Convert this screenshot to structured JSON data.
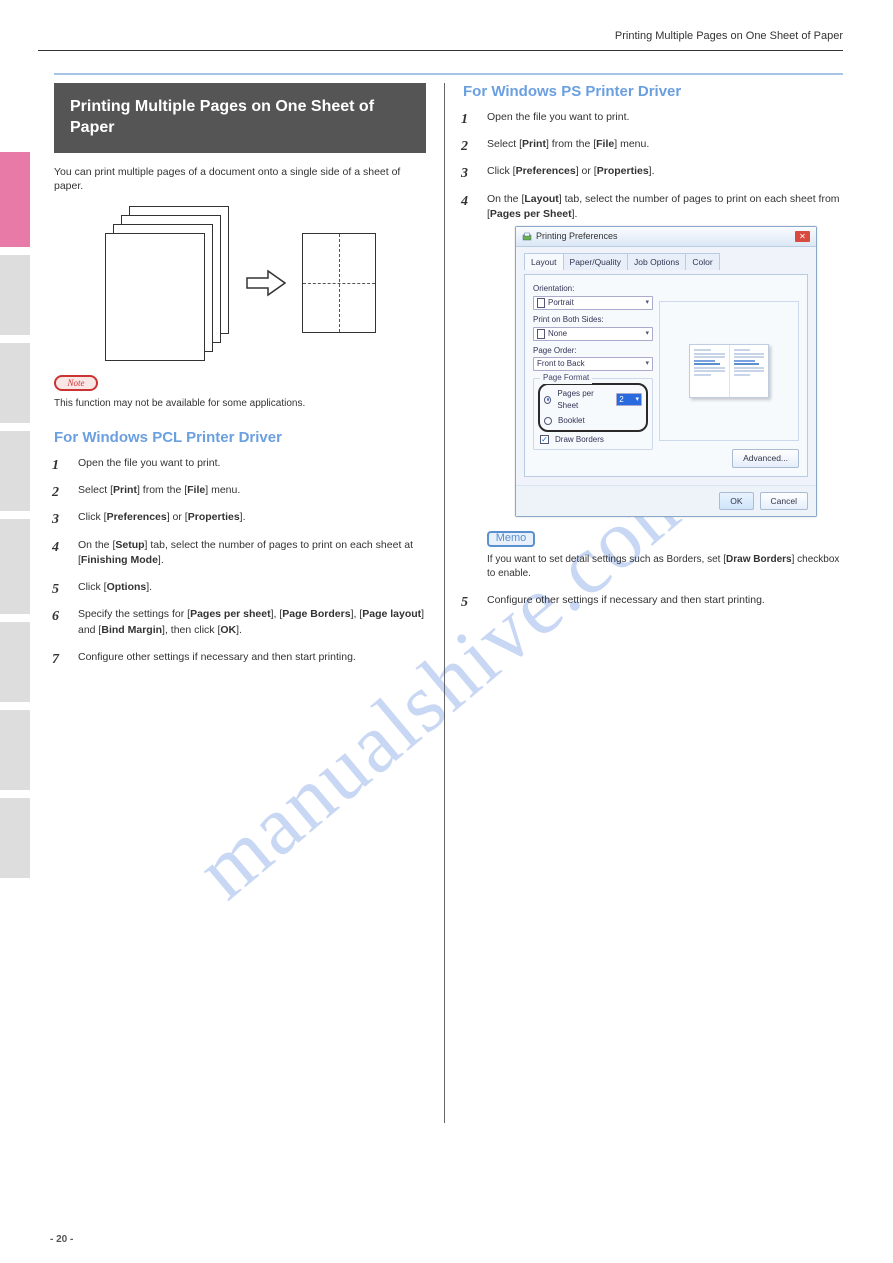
{
  "header_right": "Printing Multiple Pages on One Sheet of Paper",
  "section_title": "Printing Multiple Pages on One Sheet of Paper",
  "intro": "You can print multiple pages of a document onto a single side of a sheet of paper.",
  "note_label": "Note",
  "note_body": "This function may not be available for some applications.",
  "subheads": {
    "pcl": "For Windows PCL Printer Driver",
    "ps": "For Windows PS Printer Driver"
  },
  "pcl_steps": [
    "Open the file you want to print.",
    "Select [<b>Print</b>] from the [<b>File</b>] menu.",
    "Click [<b>Preferences</b>] or [<b>Properties</b>].",
    "On the [<b>Setup</b>] tab, select the number of pages to print on each sheet at [<b>Finishing Mode</b>].",
    "Click [<b>Options</b>].",
    "Specify the settings for [<b>Pages per sheet</b>], [<b>Page Borders</b>], [<b>Page layout</b>] and [<b>Bind Margin</b>], then click [<b>OK</b>].",
    "Configure other settings if necessary and then start printing."
  ],
  "ps_steps": [
    "Open the file you want to print.",
    "Select [<b>Print</b>] from the [<b>File</b>] menu.",
    "Click [<b>Preferences</b>] or [<b>Properties</b>].",
    "On the [<b>Layout</b>] tab, select the number of pages to print on each sheet from [<b>Pages per Sheet</b>]."
  ],
  "ps_after": "Configure other settings if necessary and then start printing.",
  "memo_label": "Memo",
  "memo_body": "If you want to set detail settings such as Borders, set [<b>Draw Borders</b>] checkbox to enable.",
  "dialog": {
    "title": "Printing Preferences",
    "tabs": [
      "Layout",
      "Paper/Quality",
      "Job Options",
      "Color"
    ],
    "orientation_label": "Orientation:",
    "orientation_value": "Portrait",
    "both_sides_label": "Print on Both Sides:",
    "both_sides_value": "None",
    "order_label": "Page Order:",
    "order_value": "Front to Back",
    "format_label": "Page Format",
    "pps_label": "Pages per Sheet",
    "pps_value": "2",
    "booklet_label": "Booklet",
    "draw_borders_label": "Draw Borders",
    "advanced": "Advanced...",
    "ok": "OK",
    "cancel": "Cancel"
  },
  "footer": {
    "page": "- 20 -"
  },
  "watermark": "manualshive.com"
}
